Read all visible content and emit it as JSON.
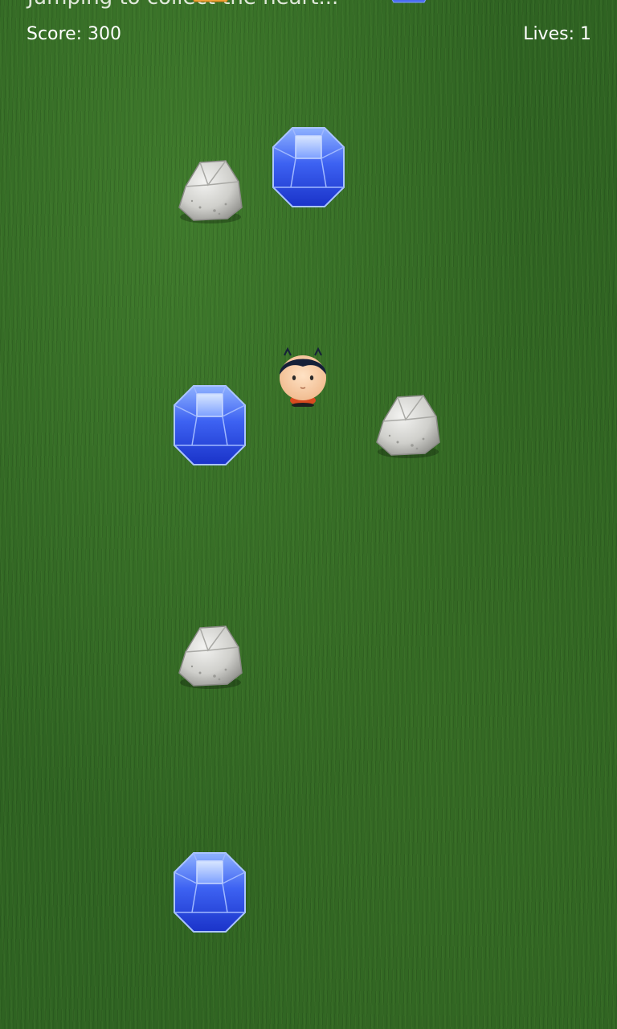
{
  "hud": {
    "top_message": "Jumping to collect the heart...",
    "score_label": "Score:",
    "score_value": "300",
    "lives_label": "Lives:",
    "lives_value": "1"
  },
  "colors": {
    "grass": "#2f6322",
    "gem_blue": "#3d62f2",
    "rock_gray": "#c9c9c9",
    "player_shirt": "#d94b1f"
  },
  "icons": {
    "gem": "blue-gem-icon",
    "rock": "rock-icon",
    "player": "player-character-icon"
  }
}
